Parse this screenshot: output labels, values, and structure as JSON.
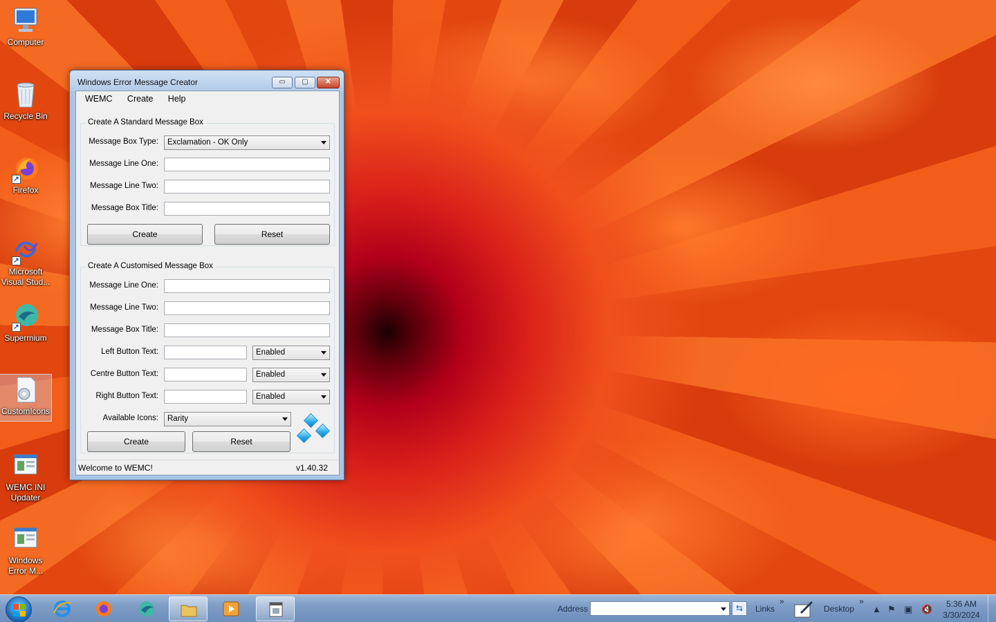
{
  "desktop": {
    "icons": [
      {
        "label": "Computer"
      },
      {
        "label": "Recycle Bin"
      },
      {
        "label": "Firefox"
      },
      {
        "label": "Microsoft Visual Stud..."
      },
      {
        "label": "Supermium"
      },
      {
        "label": "CustomIcons"
      },
      {
        "label": "WEMC INI Updater"
      },
      {
        "label": "Windows Error M..."
      }
    ]
  },
  "window": {
    "title": "Windows Error Message Creator",
    "controls": {
      "minimize": "▭",
      "maximize": "▢",
      "close": "✕"
    },
    "menu": [
      "WEMC",
      "Create",
      "Help"
    ],
    "standard": {
      "title": "Create A Standard Message Box",
      "type_label": "Message Box Type:",
      "type_value": "Exclamation - OK Only",
      "line1_label": "Message Line One:",
      "line1_value": "",
      "line2_label": "Message Line Two:",
      "line2_value": "",
      "title_label": "Message Box Title:",
      "title_value": "",
      "create": "Create",
      "reset": "Reset"
    },
    "custom": {
      "title": "Create A Customised Message Box",
      "line1_label": "Message Line One:",
      "line1_value": "",
      "line2_label": "Message Line Two:",
      "line2_value": "",
      "title_label": "Message Box Title:",
      "title_value": "",
      "left_label": "Left Button Text:",
      "left_value": "",
      "left_state": "Enabled",
      "centre_label": "Centre Button Text:",
      "centre_value": "",
      "centre_state": "Enabled",
      "right_label": "Right Button Text:",
      "right_value": "",
      "right_state": "Enabled",
      "icons_label": "Available Icons:",
      "icons_value": "Rarity",
      "create": "Create",
      "reset": "Reset"
    },
    "status": {
      "message": "Welcome to WEMC!",
      "version": "v1.40.32"
    }
  },
  "taskbar": {
    "address_label": "Address",
    "address_value": "",
    "links_label": "Links",
    "desktop_label": "Desktop",
    "chevron": "»",
    "time": "5:36 AM",
    "date": "3/30/2024"
  }
}
